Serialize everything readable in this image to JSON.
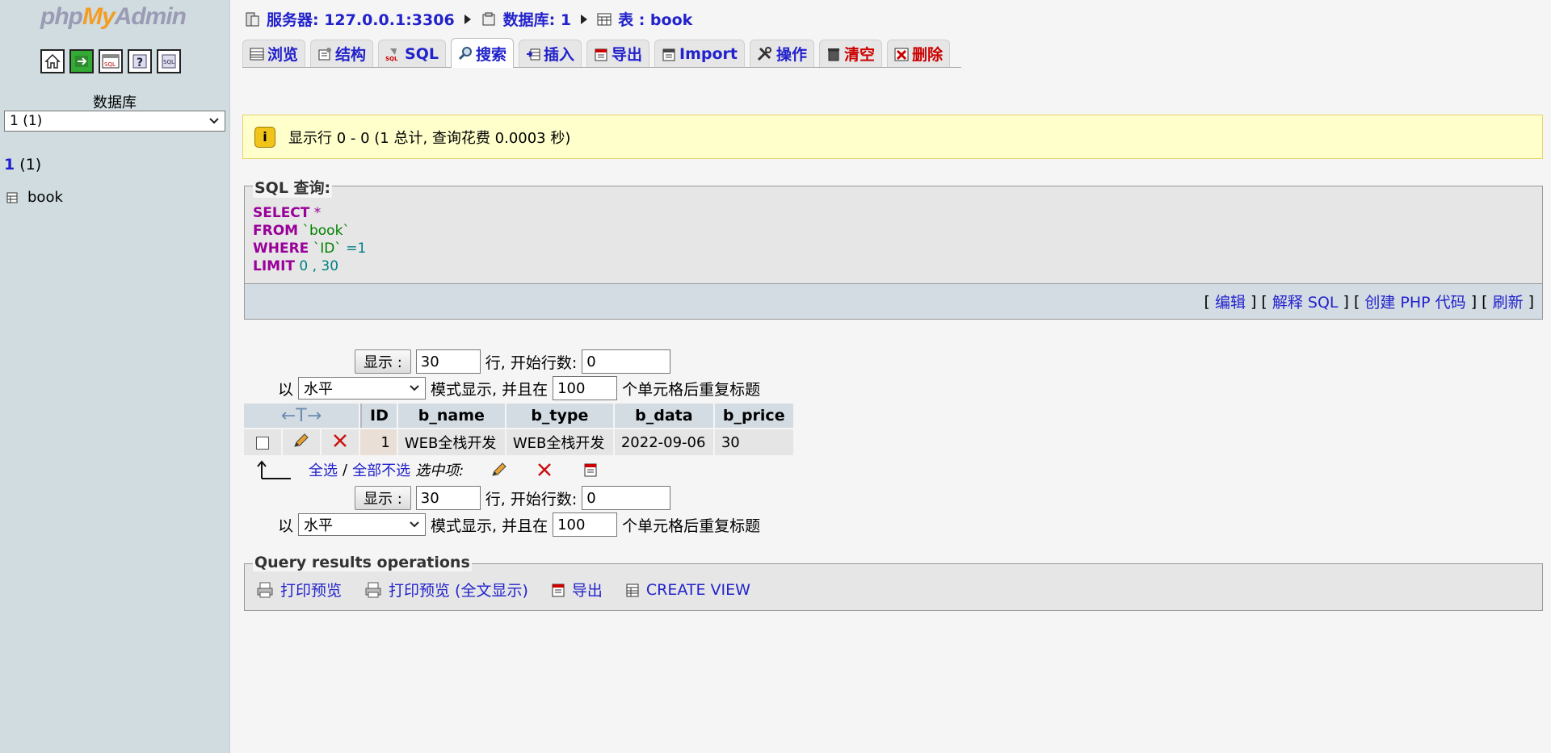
{
  "nav": {
    "logo": {
      "php": "php",
      "my": "My",
      "admin": "Admin"
    },
    "db_label": "数据库",
    "db_select": "1 (1)",
    "db_name": "1",
    "db_count": "(1)",
    "table": "book"
  },
  "breadcrumb": {
    "server": "服务器: 127.0.0.1:3306",
    "database": "数据库: 1",
    "table": "表 : book"
  },
  "tabs": [
    "浏览",
    "结构",
    "SQL",
    "搜索",
    "插入",
    "导出",
    "Import",
    "操作",
    "清空",
    "删除"
  ],
  "notice": "显示行 0 - 0 (1 总计, 查询花费 0.0003 秒)",
  "sql": {
    "legend": "SQL 查询:",
    "line1_kw": "SELECT",
    "line1_rest": " *",
    "line2_kw": "FROM",
    "line2_rest": " `book`",
    "line3_kw": "WHERE",
    "line3_str": " `ID`",
    "line3_num": " =1",
    "line4_kw": "LIMIT",
    "line4_num": " 0 , 30",
    "links": {
      "edit": "编辑",
      "explain": "解释 SQL",
      "php": "创建 PHP 代码",
      "refresh": "刷新"
    }
  },
  "display": {
    "show_btn": "显示 :",
    "rows": "30",
    "rows_label": "行, 开始行数:",
    "start": "0",
    "prefix": "以",
    "mode": "水平",
    "mode_label": "模式显示, 并且在",
    "repeat": "100",
    "repeat_label": "个单元格后重复标题"
  },
  "table": {
    "sort_arrows": "←T→",
    "headers": [
      "ID",
      "b_name",
      "b_type",
      "b_data",
      "b_price"
    ],
    "row": [
      "1",
      "WEB全栈开发",
      "WEB全栈开发",
      "2022-09-06",
      "30"
    ]
  },
  "with_selected": {
    "check_all": "全选",
    "sep": "/",
    "uncheck_all": "全部不选",
    "label": "选中项:"
  },
  "qro": {
    "legend": "Query results operations",
    "print": "打印预览",
    "print_full": "打印预览 (全文显示)",
    "export": "导出",
    "create_view": "CREATE VIEW"
  }
}
